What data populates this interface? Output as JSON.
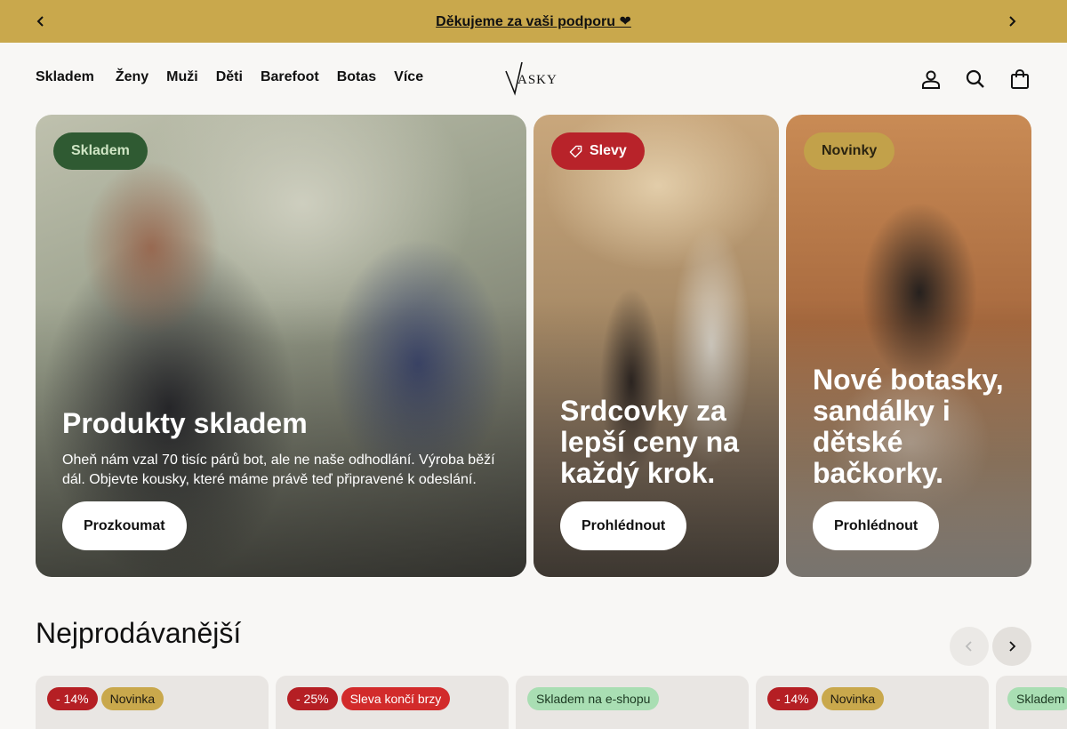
{
  "announcement": {
    "text": "Děkujeme za vaši podporu ❤"
  },
  "nav": {
    "items": [
      {
        "label": "Skladem",
        "caret": ""
      },
      {
        "label": "Ženy"
      },
      {
        "label": "Muži"
      },
      {
        "label": "Děti"
      },
      {
        "label": "Barefoot"
      },
      {
        "label": "Botas"
      },
      {
        "label": "Více"
      }
    ]
  },
  "brand": {
    "logo_text": "VASKY"
  },
  "header_icons": [
    "account-icon",
    "search-icon",
    "bag-icon"
  ],
  "hero": [
    {
      "badge": "Skladem",
      "title": "Produkty skladem",
      "description": "Oheň nám vzal 70 tisíc párů bot, ale ne naše odhodlání. Výroba běží dál. Objevte kousky, které máme právě teď připravené k odeslání.",
      "button": "Prozkoumat"
    },
    {
      "badge": "Slevy",
      "badge_icon": "tag-icon",
      "title": "Srdcovky za lepší ceny na každý krok.",
      "button": "Prohlédnout"
    },
    {
      "badge": "Novinky",
      "title": "Nové botasky, sandálky i dětské bačkorky.",
      "button": "Prohlédnout"
    }
  ],
  "bestsellers": {
    "title": "Nejprodávanější",
    "products": [
      {
        "tags": [
          "- 14%",
          "Novinka"
        ]
      },
      {
        "tags": [
          "- 25%",
          "Sleva končí brzy"
        ]
      },
      {
        "tags": [
          "Skladem na e-shopu"
        ]
      },
      {
        "tags": [
          "- 14%",
          "Novinka"
        ]
      },
      {
        "tags": [
          "Skladem"
        ]
      }
    ]
  },
  "colors": {
    "announce": "#c9a84c",
    "sale": "#b51f24",
    "stock_badge": "#2f5a32",
    "new_badge": "#c2a14a"
  }
}
